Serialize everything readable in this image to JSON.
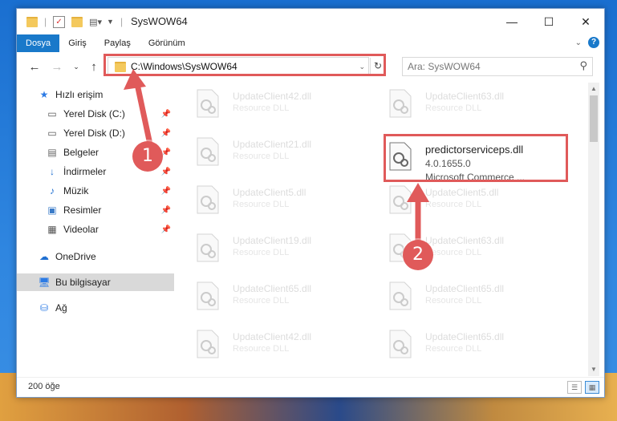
{
  "window": {
    "title": "SysWOW64",
    "minimize": "—",
    "maximize": "☐",
    "close": "✕"
  },
  "ribbon": {
    "tabs": [
      {
        "label": "Dosya",
        "active": true
      },
      {
        "label": "Giriş",
        "active": false
      },
      {
        "label": "Paylaş",
        "active": false
      },
      {
        "label": "Görünüm",
        "active": false
      }
    ],
    "help": "?"
  },
  "address": {
    "path": "C:\\Windows\\SysWOW64",
    "refresh": "↻"
  },
  "search": {
    "placeholder": "Ara: SysWOW64",
    "icon": "search-icon"
  },
  "sidebar": {
    "items": [
      {
        "label": "Hızlı erişim",
        "icon": "star-icon",
        "pinned": false
      },
      {
        "label": "Yerel Disk (C:)",
        "icon": "drive-icon",
        "pinned": true
      },
      {
        "label": "Yerel Disk (D:)",
        "icon": "drive-icon",
        "pinned": true
      },
      {
        "label": "Belgeler",
        "icon": "document-icon",
        "pinned": true
      },
      {
        "label": "İndirmeler",
        "icon": "download-icon",
        "pinned": true
      },
      {
        "label": "Müzik",
        "icon": "music-icon",
        "pinned": true
      },
      {
        "label": "Resimler",
        "icon": "pictures-icon",
        "pinned": true
      },
      {
        "label": "Videolar",
        "icon": "video-icon",
        "pinned": true
      },
      {
        "label": "OneDrive",
        "icon": "cloud-icon",
        "pinned": false
      },
      {
        "label": "Bu bilgisayar",
        "icon": "computer-icon",
        "pinned": false,
        "selected": true
      },
      {
        "label": "Ağ",
        "icon": "network-icon",
        "pinned": false
      }
    ]
  },
  "files": [
    {
      "name": "UpdateClient42.dll",
      "desc": "Resource DLL"
    },
    {
      "name": "UpdateClient63.dll",
      "desc": "Resource DLL"
    },
    {
      "name": "UpdateClient21.dll",
      "desc": "Resource DLL"
    },
    {
      "name": "predictorserviceps.dll",
      "desc": "4.0.1655.0",
      "desc2": "Microsoft Commerce ...",
      "highlight": true
    },
    {
      "name": "UpdateClient5.dll",
      "desc": "Resource DLL"
    },
    {
      "name": "UpdateClient5.dll",
      "desc": "Resource DLL"
    },
    {
      "name": "UpdateClient19.dll",
      "desc": "Resource DLL"
    },
    {
      "name": "UpdateClient63.dll",
      "desc": "Resource DLL"
    },
    {
      "name": "UpdateClient65.dll",
      "desc": "Resource DLL"
    },
    {
      "name": "UpdateClient65.dll",
      "desc": "Resource DLL"
    },
    {
      "name": "UpdateClient42.dll",
      "desc": "Resource DLL"
    },
    {
      "name": "UpdateClient65.dll",
      "desc": "Resource DLL"
    }
  ],
  "status": {
    "count": "200 öğe"
  },
  "callouts": [
    "1",
    "2"
  ],
  "colors": {
    "accent": "#1979ca",
    "highlight": "#e05a5a"
  }
}
